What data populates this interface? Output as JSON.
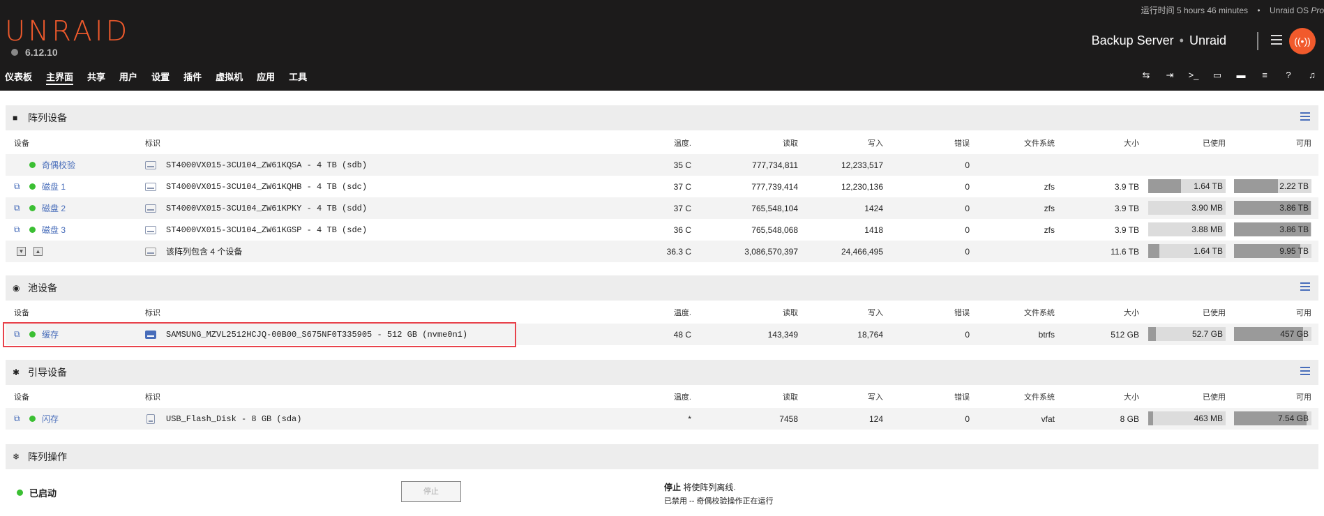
{
  "header": {
    "logo": "UNRAID",
    "version": "6.12.10",
    "uptime_label": "运行时间 5 hours 46 minutes",
    "os_name": "Unraid OS",
    "os_edition": "Pro",
    "server_name": "Backup Server",
    "server_desc": "Unraid",
    "nav": [
      "仪表板",
      "主界面",
      "共享",
      "用户",
      "设置",
      "插件",
      "虚拟机",
      "应用",
      "工具"
    ],
    "active_nav": "主界面",
    "toolbar_icons": [
      "switch-icon",
      "logout-icon",
      "terminal-icon",
      "feedback-icon",
      "monitor-icon",
      "log-icon",
      "help-icon",
      "bell-icon"
    ]
  },
  "columns": {
    "device": "设备",
    "id": "标识",
    "temp": "温度.",
    "reads": "读取",
    "writes": "写入",
    "errors": "错误",
    "fs": "文件系统",
    "size": "大小",
    "used": "已使用",
    "free": "可用"
  },
  "array": {
    "title": "阵列设备",
    "rows": [
      {
        "device": "奇偶校验",
        "id": "ST4000VX015-3CU104_ZW61KQSA - 4 TB (sdb)",
        "temp": "35 C",
        "reads": "777,734,811",
        "writes": "12,233,517",
        "errors": "0",
        "fs": "",
        "size": "",
        "used": "",
        "free": "",
        "used_frac": 0,
        "free_frac": 0
      },
      {
        "device": "磁盘 1",
        "id": "ST4000VX015-3CU104_ZW61KQHB - 4 TB (sdc)",
        "temp": "37 C",
        "reads": "777,739,414",
        "writes": "12,230,136",
        "errors": "0",
        "fs": "zfs",
        "size": "3.9 TB",
        "used": "1.64 TB",
        "free": "2.22 TB",
        "used_frac": 0.42,
        "free_frac": 0.57
      },
      {
        "device": "磁盘 2",
        "id": "ST4000VX015-3CU104_ZW61KPKY - 4 TB (sdd)",
        "temp": "37 C",
        "reads": "765,548,104",
        "writes": "1424",
        "errors": "0",
        "fs": "zfs",
        "size": "3.9 TB",
        "used": "3.90 MB",
        "free": "3.86 TB",
        "used_frac": 0.0,
        "free_frac": 0.99
      },
      {
        "device": "磁盘 3",
        "id": "ST4000VX015-3CU104_ZW61KGSP - 4 TB (sde)",
        "temp": "36 C",
        "reads": "765,548,068",
        "writes": "1418",
        "errors": "0",
        "fs": "zfs",
        "size": "3.9 TB",
        "used": "3.88 MB",
        "free": "3.86 TB",
        "used_frac": 0.0,
        "free_frac": 0.99
      }
    ],
    "summary": {
      "id": "该阵列包含 4 个设备",
      "temp": "36.3 C",
      "reads": "3,086,570,397",
      "writes": "24,466,495",
      "errors": "0",
      "size": "11.6 TB",
      "used": "1.64 TB",
      "free": "9.95 TB",
      "used_frac": 0.14,
      "free_frac": 0.86
    }
  },
  "pool": {
    "title": "池设备",
    "rows": [
      {
        "device": "缓存",
        "id": "SAMSUNG_MZVL2512HCJQ-00B00_S675NF0T335905 - 512 GB (nvme0n1)",
        "temp": "48 C",
        "reads": "143,349",
        "writes": "18,764",
        "errors": "0",
        "fs": "btrfs",
        "size": "512 GB",
        "used": "52.7 GB",
        "free": "457 GB",
        "used_frac": 0.1,
        "free_frac": 0.89
      }
    ]
  },
  "boot": {
    "title": "引导设备",
    "rows": [
      {
        "device": "闪存",
        "id": "USB_Flash_Disk - 8 GB (sda)",
        "temp": "*",
        "reads": "7458",
        "writes": "124",
        "errors": "0",
        "fs": "vfat",
        "size": "8 GB",
        "used": "463 MB",
        "free": "7.54 GB",
        "used_frac": 0.06,
        "free_frac": 0.94
      }
    ]
  },
  "ops": {
    "title": "阵列操作",
    "status": "已启动",
    "stop_button": "停止",
    "stop_msg_bold": "停止",
    "stop_msg": " 将使阵列离线.",
    "stop_note": "已禁用 -- 奇偶校验操作正在运行"
  }
}
